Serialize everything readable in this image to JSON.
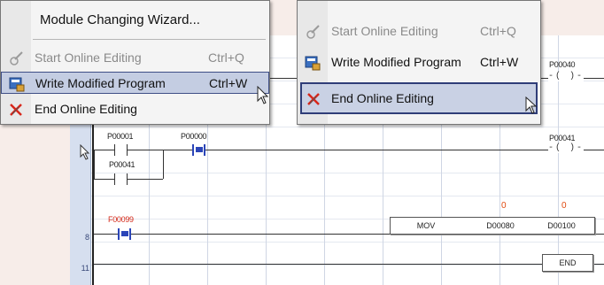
{
  "menu_left": {
    "items": [
      {
        "label": "Module Changing Wizard...",
        "shortcut": "",
        "icon": "none",
        "state": "normal"
      },
      {
        "label": "Start Online Editing",
        "shortcut": "Ctrl+Q",
        "icon": "pencil-gear-icon",
        "state": "disabled"
      },
      {
        "label": "Write Modified Program",
        "shortcut": "Ctrl+W",
        "icon": "write-program-icon",
        "state": "highlighted"
      },
      {
        "label": "End Online Editing",
        "shortcut": "",
        "icon": "end-edit-icon",
        "state": "normal"
      }
    ]
  },
  "menu_right": {
    "items": [
      {
        "label": "Start Online Editing",
        "shortcut": "Ctrl+Q",
        "icon": "pencil-gear-icon",
        "state": "disabled"
      },
      {
        "label": "Write Modified Program",
        "shortcut": "Ctrl+W",
        "icon": "write-program-icon",
        "state": "normal"
      },
      {
        "label": "End Online Editing",
        "shortcut": "",
        "icon": "end-edit-icon",
        "state": "highlighted"
      }
    ]
  },
  "ladder": {
    "line_numbers": [
      "8",
      "11"
    ],
    "rung1": {
      "coil": "P00040"
    },
    "rung2": {
      "contacts": [
        "P00001",
        "P00000",
        "P00041"
      ],
      "coil": "P00041"
    },
    "rung3": {
      "contact": "F00099",
      "instruction": "MOV",
      "operand1": "D00080",
      "operand2": "D00100",
      "value1": "0",
      "value2": "0"
    },
    "end_label": "END"
  },
  "colors": {
    "highlight": "#c4cde2",
    "active_contact": "#2b45b8",
    "special_contact_text": "#d42a1a",
    "monitor_value": "#e04a10"
  }
}
